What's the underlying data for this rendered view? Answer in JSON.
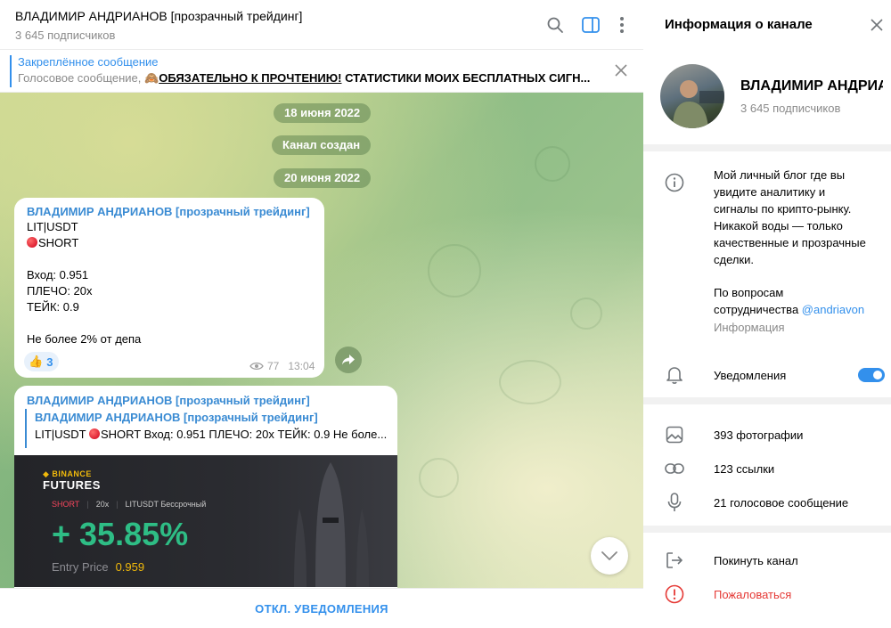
{
  "chat": {
    "title": "ВЛАДИМИР АНДРИАНОВ [прозрачный трейдинг]",
    "subscribers": "3 645 подписчиков",
    "pinned": {
      "title": "Закреплённое сообщение",
      "prefix": "Голосовое сообщение, ",
      "emoji": "🙈",
      "bold": "ОБЯЗАТЕЛЬНО К ПРОЧТЕНИЮ!",
      "rest": "  СТАТИСТИКИ МОИХ БЕСПЛАТНЫХ СИГН..."
    },
    "dates": [
      "18 июня 2022",
      "Канал создан",
      "20 июня 2022"
    ],
    "message1": {
      "author": "ВЛАДИМИР АНДРИАНОВ [прозрачный трейдинг]",
      "pair": "LIT|USDT",
      "side": "SHORT",
      "entry": "Вход: 0.951",
      "leverage": "ПЛЕЧО: 20x",
      "take": "ТЕЙК: 0.9",
      "note": "Не более 2% от депа",
      "reaction_emoji": "👍",
      "reaction_count": "3",
      "views": "77",
      "time": "13:04"
    },
    "message2": {
      "author": "ВЛАДИМИР АНДРИАНОВ [прозрачный трейдинг]",
      "quote_author": "ВЛАДИМИР АНДРИАНОВ [прозрачный трейдинг]",
      "quote_pre": "LIT|USDT ",
      "quote_post": "SHORT  Вход: 0.951 ПЛЕЧО: 20x ТЕЙК: 0.9  Не боле...",
      "card": {
        "brand": "BINANCE",
        "product": "FUTURES",
        "side": "SHORT",
        "leverage": "20x",
        "contract": "LITUSDT Бессрочный",
        "profit": "+ 35.85%",
        "entry_label": "Entry Price",
        "entry_value": "0.959"
      }
    },
    "footer_button": "ОТКЛ. УВЕДОМЛЕНИЯ"
  },
  "info": {
    "title": "Информация о канале",
    "name": "ВЛАДИМИР АНДРИАНОВ [прозрачный трейдинг]",
    "subscribers": "3 645 подписчиков",
    "description": [
      "Мой личный блог где вы",
      "увидите аналитику и",
      "сигналы по крипто-рынку.",
      "Никакой воды — только",
      "качественные и прозрачные",
      "сделки."
    ],
    "contact_line1": "По вопросам",
    "contact_line2": "сотрудничества ",
    "contact_handle": "@andriavon",
    "description_label": "Информация",
    "notifications_label": "Уведомления",
    "notifications_on": true,
    "media": {
      "photos": "393 фотографии",
      "links": "123 ссылки",
      "voice": "21 голосовое сообщение"
    },
    "leave": "Покинуть канал",
    "report": "Пожаловаться"
  },
  "colors": {
    "accent": "#3390ec",
    "danger": "#e53935",
    "profit": "#2ebd85",
    "binance": "#f0b90b"
  }
}
